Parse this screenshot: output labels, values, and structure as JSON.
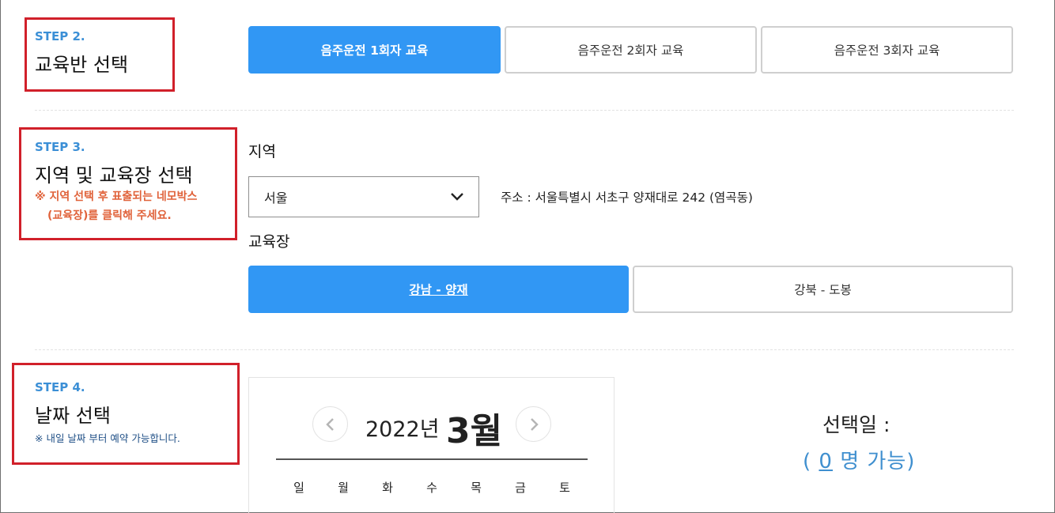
{
  "step2": {
    "step": "STEP 2.",
    "title": "교육반 선택",
    "options": [
      "음주운전 1회자 교육",
      "음주운전 2회자 교육",
      "음주운전 3회자 교육"
    ],
    "selected_index": 0
  },
  "step3": {
    "step": "STEP 3.",
    "title": "지역 및 교육장 선택",
    "note_line1": "※ 지역 선택 후 표출되는 네모박스",
    "note_line2": "(교육장)를 클릭해 주세요.",
    "region_label": "지역",
    "region_value": "서울",
    "address": "주소 : 서울특별시 서초구 양재대로 242 (염곡동)",
    "center_label": "교육장",
    "centers": [
      "강남 - 양재",
      "강북 - 도봉"
    ],
    "selected_center_index": 0
  },
  "step4": {
    "step": "STEP 4.",
    "title": "날짜 선택",
    "note": "※ 내일 날짜 부터 예약 가능합니다.",
    "calendar": {
      "year": "2022년",
      "month": "3월",
      "weekdays": [
        "일",
        "월",
        "화",
        "수",
        "목",
        "금",
        "토"
      ]
    },
    "selected_date_label": "선택일 :",
    "available_open": "( ",
    "available_count": "0",
    "available_suffix": " 명 가능)"
  },
  "colors": {
    "accent": "#3197f4",
    "step_blue": "#3b8fd6",
    "highlight_red": "#d1202a",
    "note_orange": "#e0623a"
  }
}
